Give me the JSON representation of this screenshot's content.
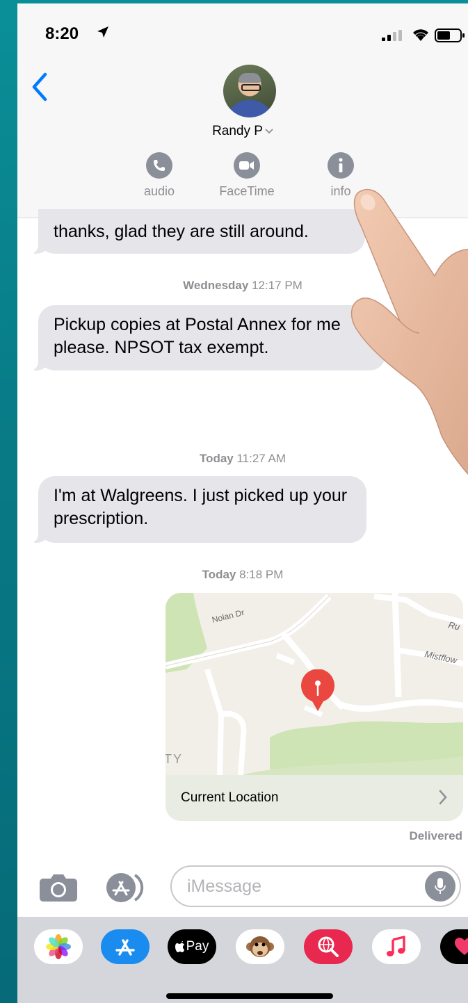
{
  "status_bar": {
    "time": "8:20"
  },
  "header": {
    "contact_name": "Randy P",
    "actions": [
      {
        "label": "audio",
        "icon": "phone-icon"
      },
      {
        "label": "FaceTime",
        "icon": "video-icon"
      },
      {
        "label": "info",
        "icon": "info-icon"
      }
    ]
  },
  "messages": [
    {
      "type": "received",
      "text": "thanks, glad they are still around."
    },
    {
      "type": "timestamp",
      "day": "Wednesday",
      "time": "12:17 PM"
    },
    {
      "type": "received",
      "text": "Pickup copies at Postal Annex for me please. NPSOT tax exempt."
    },
    {
      "type": "timestamp",
      "day": "Today",
      "time": "11:27 AM"
    },
    {
      "type": "received",
      "text": "I'm at Walgreens. I just picked up your prescription."
    },
    {
      "type": "timestamp",
      "day": "Today",
      "time": "8:18 PM"
    }
  ],
  "map_card": {
    "street_labels": [
      "Nolan Dr",
      "Mistflow",
      "Ru",
      "TY"
    ],
    "footer_label": "Current Location"
  },
  "delivered": "Delivered",
  "input": {
    "placeholder": "iMessage"
  },
  "app_drawer": [
    {
      "name": "photos-app",
      "icon": "photos-icon"
    },
    {
      "name": "app-store-app",
      "icon": "app-store-icon"
    },
    {
      "name": "apple-pay-app",
      "icon": "apple-pay-icon",
      "label": "Pay"
    },
    {
      "name": "animoji-app",
      "icon": "monkey-icon"
    },
    {
      "name": "web-search-app",
      "icon": "globe-search-icon"
    },
    {
      "name": "music-app",
      "icon": "music-note-icon"
    },
    {
      "name": "digital-touch-app",
      "icon": "heart-icon"
    }
  ],
  "colors": {
    "bubble_gray": "#e5e5ea",
    "ios_blue": "#007aff",
    "map_pin_red": "#e9473f",
    "background_teal": "#0a8f98"
  }
}
